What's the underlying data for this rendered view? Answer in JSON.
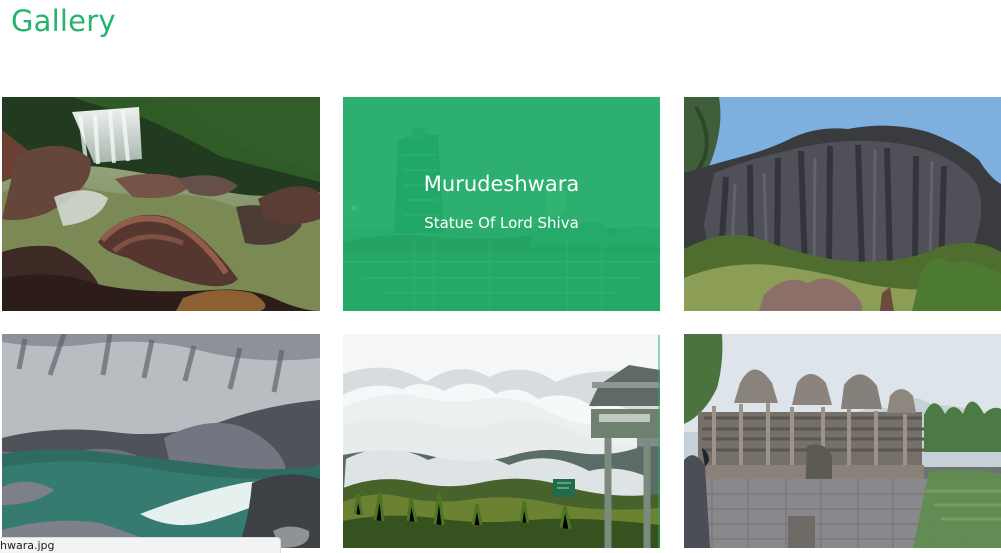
{
  "page": {
    "title": "Gallery"
  },
  "gallery": {
    "items": [
      {
        "label": "waterfall-photo"
      },
      {
        "label": "murudeshwara-photo",
        "title": "Murudeshwara",
        "subtitle": "Statue Of Lord Shiva"
      },
      {
        "label": "rock-formation-photo"
      },
      {
        "label": "gorge-photo"
      },
      {
        "label": "misty-hills-photo"
      },
      {
        "label": "temple-photo"
      }
    ]
  },
  "browser": {
    "status_url": "hwara.jpg"
  },
  "colors": {
    "accent": "#25b36d",
    "overlay": "#25b36d",
    "status_bg": "#f1f3f4"
  }
}
